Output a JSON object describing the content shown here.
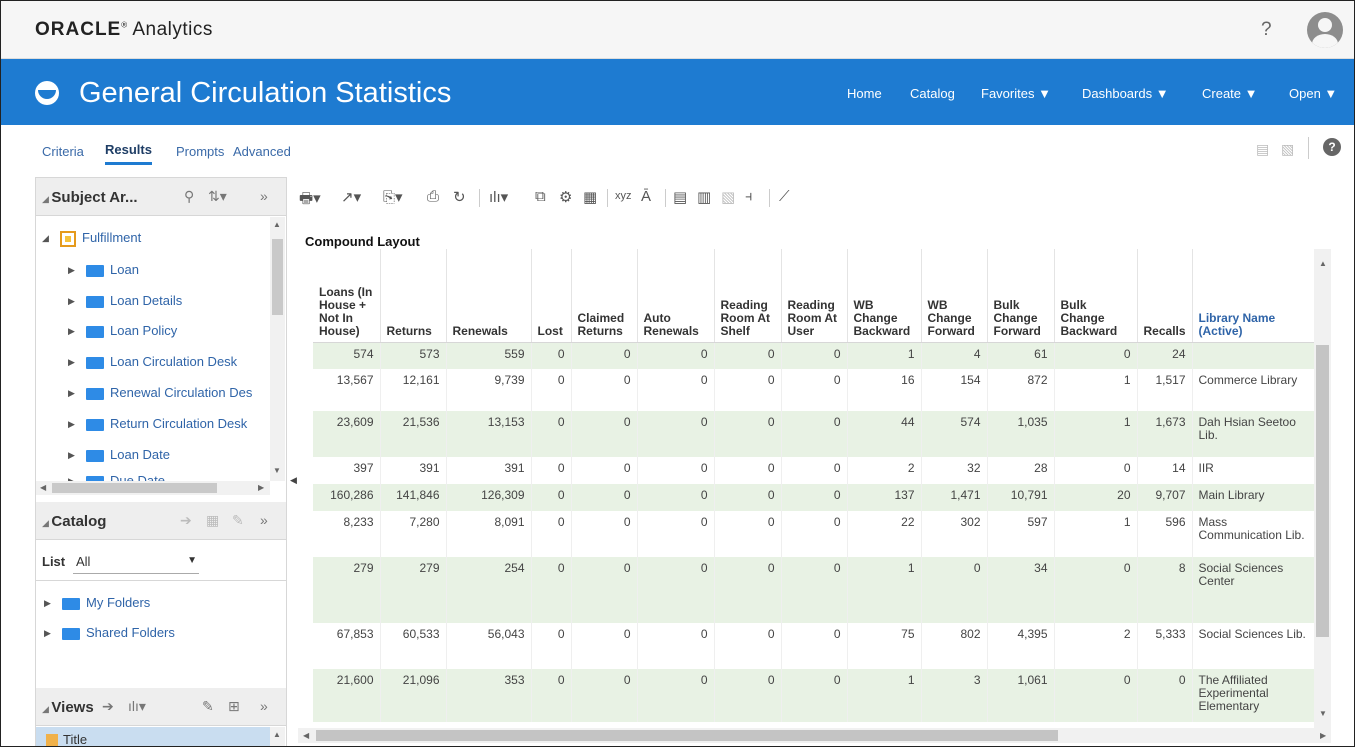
{
  "topbar": {
    "brand_bold": "ORACLE",
    "brand_mark": "®",
    "brand_rest": " Analytics",
    "help": "?"
  },
  "header": {
    "title": "General Circulation Statistics",
    "nav": [
      {
        "label": "Home"
      },
      {
        "label": "Catalog"
      },
      {
        "label": "Favorites ▼"
      },
      {
        "label": "Dashboards ▼"
      },
      {
        "label": "Create ▼"
      },
      {
        "label": "Open ▼"
      }
    ]
  },
  "tabs": [
    {
      "label": "Criteria",
      "active": false
    },
    {
      "label": "Results",
      "active": true
    },
    {
      "label": "Prompts",
      "active": false
    },
    {
      "label": "Advanced",
      "active": false
    }
  ],
  "subject_area": {
    "title": "Subject Ar...",
    "root": "Fulfillment",
    "items": [
      "Loan",
      "Loan Details",
      "Loan Policy",
      "Loan Circulation Desk",
      "Renewal Circulation Des",
      "Return Circulation Desk",
      "Loan Date",
      "Due Date"
    ]
  },
  "catalog": {
    "title": "Catalog",
    "list_label": "List",
    "list_value": "All",
    "items": [
      "My Folders",
      "Shared Folders"
    ]
  },
  "views": {
    "title": "Views",
    "first_item": "Title"
  },
  "results": {
    "layout_title": "Compound Layout",
    "headers": [
      "Loans (In House + Not In House)",
      "Returns",
      "Renewals",
      "Lost",
      "Claimed Returns",
      "Auto Renewals",
      "Reading Room At Shelf",
      "Reading Room At User",
      "WB Change Backward",
      "WB Change Forward",
      "Bulk Change Forward",
      "Bulk Change Backward",
      "Recalls",
      "Library Name (Active)"
    ],
    "rows": [
      [
        "574",
        "573",
        "559",
        "0",
        "0",
        "0",
        "0",
        "0",
        "1",
        "4",
        "61",
        "0",
        "24",
        ""
      ],
      [
        "13,567",
        "12,161",
        "9,739",
        "0",
        "0",
        "0",
        "0",
        "0",
        "16",
        "154",
        "872",
        "1",
        "1,517",
        "Commerce Library"
      ],
      [
        "23,609",
        "21,536",
        "13,153",
        "0",
        "0",
        "0",
        "0",
        "0",
        "44",
        "574",
        "1,035",
        "1",
        "1,673",
        "Dah Hsian Seetoo Lib."
      ],
      [
        "397",
        "391",
        "391",
        "0",
        "0",
        "0",
        "0",
        "0",
        "2",
        "32",
        "28",
        "0",
        "14",
        "IIR"
      ],
      [
        "160,286",
        "141,846",
        "126,309",
        "0",
        "0",
        "0",
        "0",
        "0",
        "137",
        "1,471",
        "10,791",
        "20",
        "9,707",
        "Main Library"
      ],
      [
        "8,233",
        "7,280",
        "8,091",
        "0",
        "0",
        "0",
        "0",
        "0",
        "22",
        "302",
        "597",
        "1",
        "596",
        "Mass Communication Lib."
      ],
      [
        "279",
        "279",
        "254",
        "0",
        "0",
        "0",
        "0",
        "0",
        "1",
        "0",
        "34",
        "0",
        "8",
        "Social Sciences Center"
      ],
      [
        "67,853",
        "60,533",
        "56,043",
        "0",
        "0",
        "0",
        "0",
        "0",
        "75",
        "802",
        "4,395",
        "2",
        "5,333",
        "Social Sciences Lib."
      ],
      [
        "21,600",
        "21,096",
        "353",
        "0",
        "0",
        "0",
        "0",
        "0",
        "1",
        "3",
        "1,061",
        "0",
        "0",
        "The Affiliated Experimental Elementary"
      ]
    ]
  },
  "colors": {
    "header_blue": "#1e7bd1",
    "band_green": "#e8f2e4",
    "link_blue": "#2f64a8"
  }
}
